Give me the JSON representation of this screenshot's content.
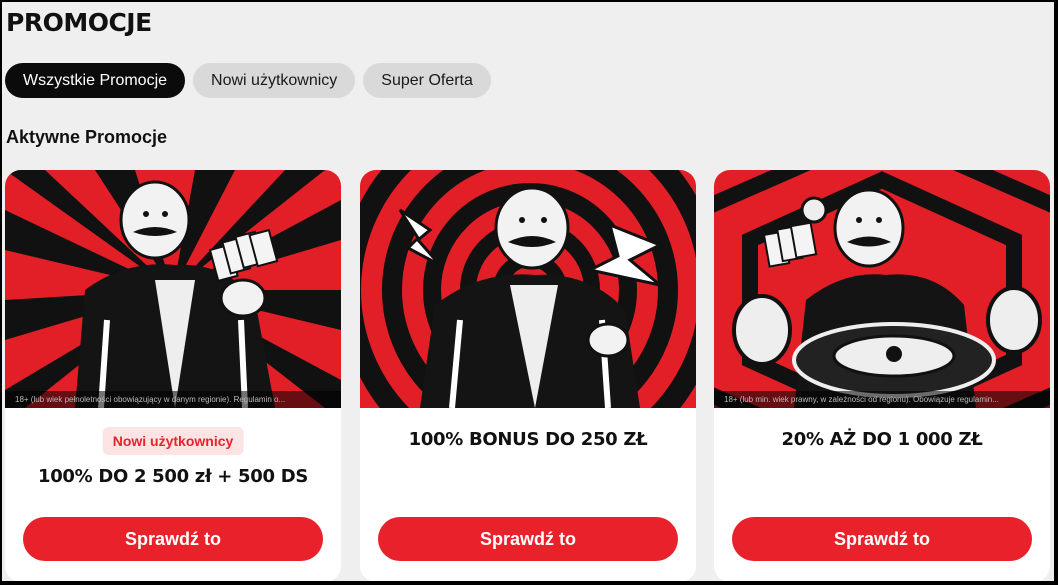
{
  "page": {
    "title": "PROMOCJE"
  },
  "tabs": [
    {
      "label": "Wszystkie Promocje",
      "active": true
    },
    {
      "label": "Nowi użytkownicy",
      "active": false
    },
    {
      "label": "Super Oferta",
      "active": false
    }
  ],
  "section": {
    "title": "Aktywne Promocje"
  },
  "colors": {
    "accent": "#e8212a",
    "badge_bg": "#fde4e4",
    "tab_active": "#0b0b0b",
    "tab_inactive": "#d9d9d9"
  },
  "cards": [
    {
      "disclaimer": "18+ (lub wiek pełnoletności obowiązujący w danym regionie). Regulamin o...",
      "badge": "Nowi użytkownicy",
      "offer": "100% DO 2 500 zł + 500 DS",
      "cta": "Sprawdź to",
      "image_icon": "mustache-man-with-cash-illustration"
    },
    {
      "disclaimer": "",
      "badge": "",
      "offer": "100% BONUS DO 250 ZŁ",
      "cta": "Sprawdź to",
      "image_icon": "mustache-man-running-lightning-illustration"
    },
    {
      "disclaimer": "18+ (lub min. wiek prawny, w zależności od regionu). Obowiązuje regulamin...",
      "badge": "",
      "offer": "20% AŻ DO 1 000 ZŁ",
      "cta": "Sprawdź to",
      "image_icon": "mustache-man-roulette-illustration"
    }
  ]
}
